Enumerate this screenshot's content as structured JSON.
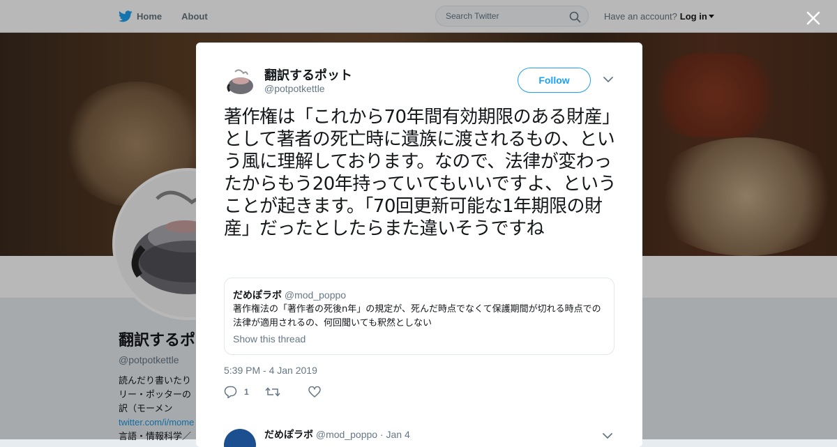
{
  "nav": {
    "home_label": "Home",
    "about_label": "About",
    "search_placeholder": "Search Twitter",
    "have_account_label": "Have an account?",
    "login_label": "Log in"
  },
  "profile": {
    "name": "翻訳するポ",
    "handle": "@potpotkettle",
    "bio_lines": [
      "読んだり書いたり",
      "リー・ポッターの",
      "訳（モーメン"
    ],
    "link": "twitter.com/i/mome",
    "extra": "言語・情報科学／"
  },
  "tweet": {
    "author_name": "翻訳するポット",
    "author_handle": "@potpotkettle",
    "follow_label": "Follow",
    "text": "著作権は「これから70年間有効期限のある財産」として著者の死亡時に遺族に渡されるもの、という風に理解しております。なので、法律が変わったからもう20年持っていてもいいですよ、ということが起きます。「70回更新可能な1年期限の財産」だったとしたらまた違いそうですね",
    "timestamp": "5:39 PM - 4 Jan 2019",
    "reply_count": "1",
    "retweet_count": "",
    "like_count": ""
  },
  "quote": {
    "name": "だめぽラボ",
    "handle": "@mod_poppo",
    "text": "著作権法の「著作者の死後n年」の規定が、死んだ時点でなくて保護期間が切れる時点での法律が適用されるの、何回聞いても釈然としない",
    "show_thread_label": "Show this thread"
  },
  "reply": {
    "name": "だめぽラボ",
    "handle": "@mod_poppo",
    "date": "· Jan 4"
  },
  "colors": {
    "brand_blue": "#1da1f2",
    "secondary_text": "#657786",
    "border": "#e1e8ed"
  }
}
